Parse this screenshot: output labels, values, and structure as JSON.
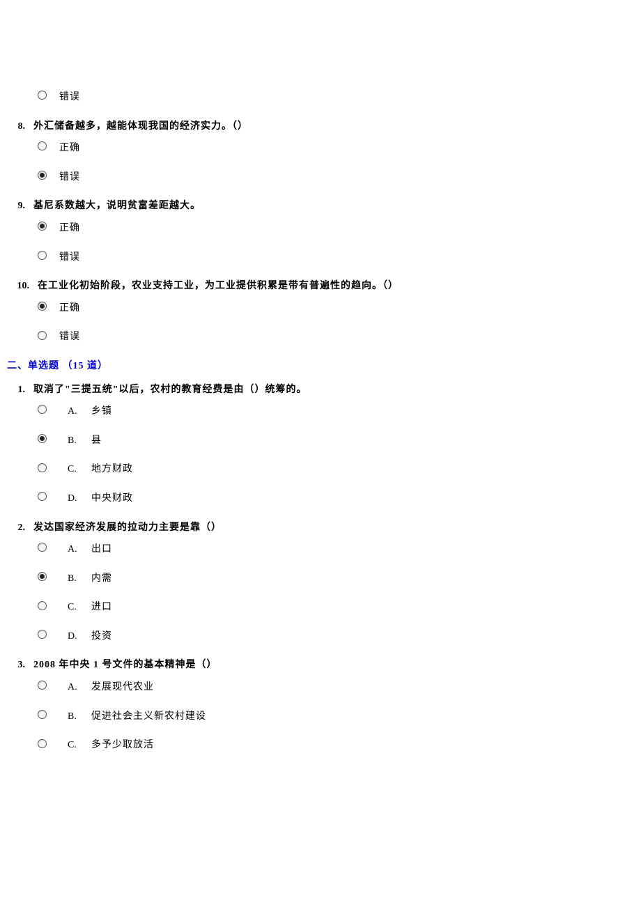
{
  "tf_continued": {
    "q7_tail_option": {
      "label": "错误",
      "selected": false
    },
    "questions": [
      {
        "number": "8.",
        "text": "外汇储备越多，越能体现我国的经济实力。（）",
        "options": [
          {
            "label": "正确",
            "selected": false
          },
          {
            "label": "错误",
            "selected": true
          }
        ]
      },
      {
        "number": "9.",
        "text": "基尼系数越大，说明贫富差距越大。",
        "options": [
          {
            "label": "正确",
            "selected": true
          },
          {
            "label": "错误",
            "selected": false
          }
        ]
      },
      {
        "number": "10.",
        "text": "在工业化初始阶段，农业支持工业，为工业提供积累是带有普遍性的趋向。（）",
        "options": [
          {
            "label": "正确",
            "selected": true
          },
          {
            "label": "错误",
            "selected": false
          }
        ]
      }
    ]
  },
  "section2_title": "二、单选题 （15 道）",
  "mc_questions": [
    {
      "number": "1.",
      "text": "取消了\"三提五统\"以后，农村的教育经费是由（）统筹的。",
      "options": [
        {
          "letter": "A.",
          "label": "乡镇",
          "selected": false
        },
        {
          "letter": "B.",
          "label": "县",
          "selected": true
        },
        {
          "letter": "C.",
          "label": "地方财政",
          "selected": false
        },
        {
          "letter": "D.",
          "label": "中央财政",
          "selected": false
        }
      ]
    },
    {
      "number": "2.",
      "text": "发达国家经济发展的拉动力主要是靠（）",
      "options": [
        {
          "letter": "A.",
          "label": "出口",
          "selected": false
        },
        {
          "letter": "B.",
          "label": "内需",
          "selected": true
        },
        {
          "letter": "C.",
          "label": "进口",
          "selected": false
        },
        {
          "letter": "D.",
          "label": "投资",
          "selected": false
        }
      ]
    },
    {
      "number": "3.",
      "text": "2008 年中央 1 号文件的基本精神是（）",
      "options": [
        {
          "letter": "A.",
          "label": "发展现代农业",
          "selected": false
        },
        {
          "letter": "B.",
          "label": "促进社会主义新农村建设",
          "selected": false
        },
        {
          "letter": "C.",
          "label": "多予少取放活",
          "selected": false
        }
      ]
    }
  ]
}
